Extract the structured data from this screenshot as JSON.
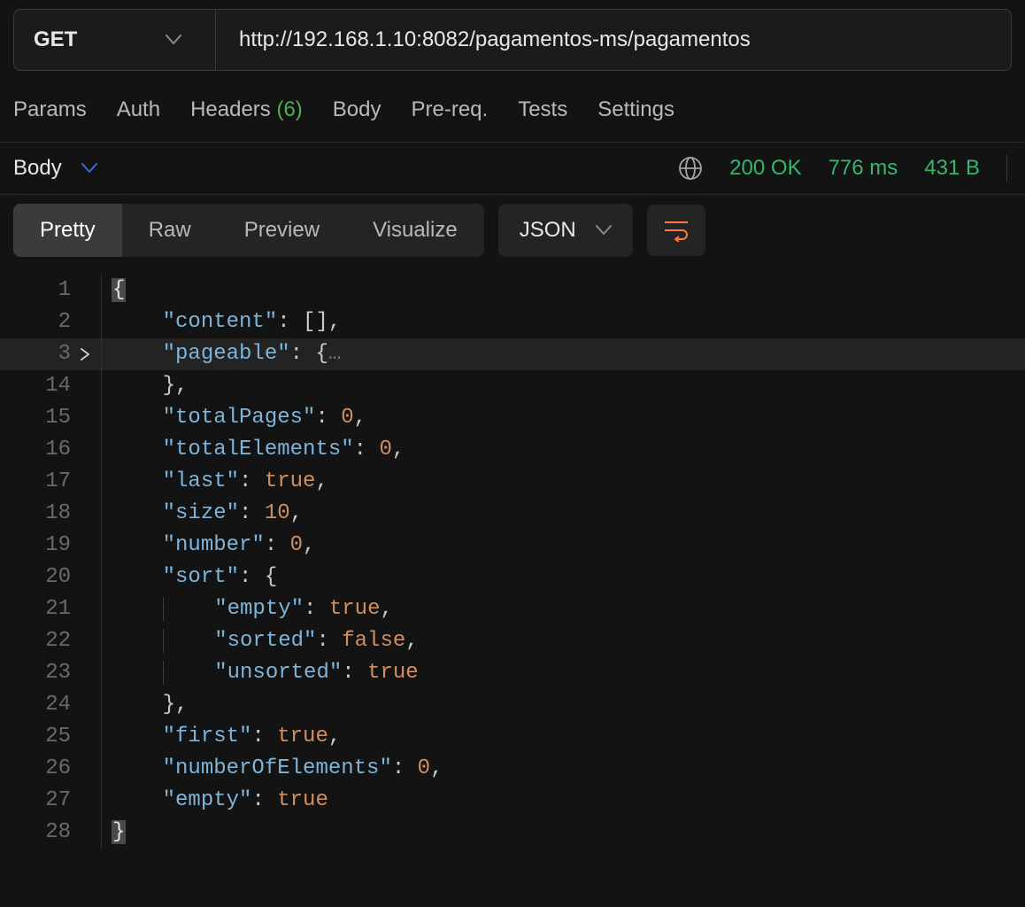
{
  "request": {
    "method": "GET",
    "url": "http://192.168.1.10:8082/pagamentos-ms/pagamentos"
  },
  "request_tabs": {
    "params": "Params",
    "auth": "Auth",
    "headers_label": "Headers",
    "headers_count": "(6)",
    "body": "Body",
    "prereq": "Pre-req.",
    "tests": "Tests",
    "settings": "Settings"
  },
  "response": {
    "selector": "Body",
    "status": "200 OK",
    "time": "776 ms",
    "size": "431 B"
  },
  "view_tabs": {
    "pretty": "Pretty",
    "raw": "Raw",
    "preview": "Preview",
    "visualize": "Visualize"
  },
  "lang": "JSON",
  "code": {
    "l1_num": "1",
    "l1_open": "{",
    "l2_num": "2",
    "l2_key": "\"content\"",
    "l2_val": "[]",
    "l3_num": "3",
    "l3_key": "\"pageable\"",
    "l3_open": "{",
    "l3_ellip": "…",
    "l14_num": "14",
    "l14_close": "}",
    "l15_num": "15",
    "l15_key": "\"totalPages\"",
    "l15_val": "0",
    "l16_num": "16",
    "l16_key": "\"totalElements\"",
    "l16_val": "0",
    "l17_num": "17",
    "l17_key": "\"last\"",
    "l17_val": "true",
    "l18_num": "18",
    "l18_key": "\"size\"",
    "l18_val": "10",
    "l19_num": "19",
    "l19_key": "\"number\"",
    "l19_val": "0",
    "l20_num": "20",
    "l20_key": "\"sort\"",
    "l20_open": "{",
    "l21_num": "21",
    "l21_key": "\"empty\"",
    "l21_val": "true",
    "l22_num": "22",
    "l22_key": "\"sorted\"",
    "l22_val": "false",
    "l23_num": "23",
    "l23_key": "\"unsorted\"",
    "l23_val": "true",
    "l24_num": "24",
    "l24_close": "}",
    "l25_num": "25",
    "l25_key": "\"first\"",
    "l25_val": "true",
    "l26_num": "26",
    "l26_key": "\"numberOfElements\"",
    "l26_val": "0",
    "l27_num": "27",
    "l27_key": "\"empty\"",
    "l27_val": "true",
    "l28_num": "28",
    "l28_close": "}",
    "colon": ":",
    "comma": ","
  }
}
